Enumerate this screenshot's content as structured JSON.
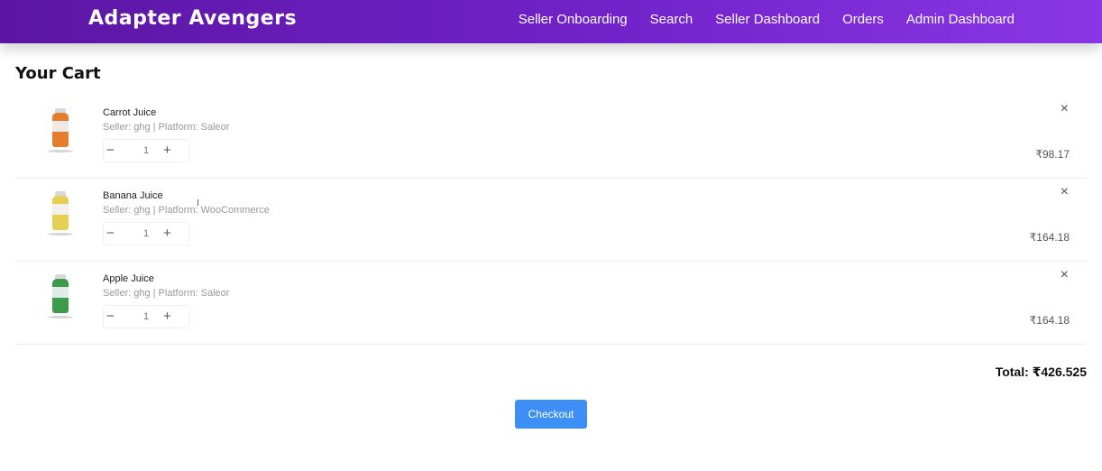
{
  "header": {
    "brand": "Adapter Avengers",
    "nav": [
      "Seller Onboarding",
      "Search",
      "Seller Dashboard",
      "Orders",
      "Admin Dashboard"
    ]
  },
  "page_title": "Your Cart",
  "cart": {
    "items": [
      {
        "name": "Carrot Juice",
        "meta": "Seller: ghg | Platform: Saleor",
        "quantity": "1",
        "price": "₹98.17",
        "color": "#e47d2d"
      },
      {
        "name": "Banana Juice",
        "meta": "Seller: ghg | Platform: WooCommerce",
        "quantity": "1",
        "price": "₹164.18",
        "color": "#e6cf55"
      },
      {
        "name": "Apple Juice",
        "meta": "Seller: ghg | Platform: Saleor",
        "quantity": "1",
        "price": "₹164.18",
        "color": "#3d9a4b"
      }
    ],
    "minus_label": "−",
    "plus_label": "+",
    "remove_label": "×",
    "total": "Total: ₹426.525",
    "checkout_label": "Checkout"
  }
}
